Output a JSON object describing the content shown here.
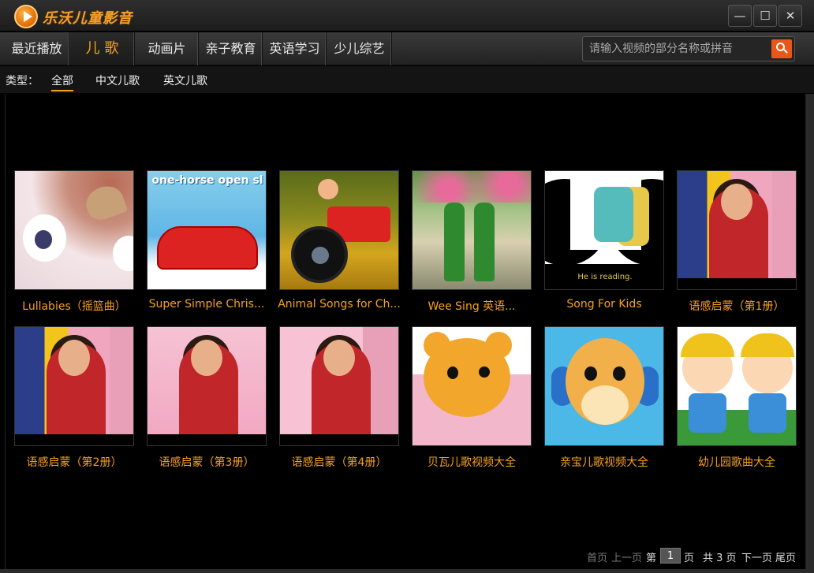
{
  "app": {
    "title": "乐沃儿童影音"
  },
  "window": {
    "minimize": "—",
    "maximize": "☐",
    "close": "✕"
  },
  "nav": {
    "items": [
      {
        "label": "最近播放",
        "active": false
      },
      {
        "label": "儿 歌",
        "active": true
      },
      {
        "label": "动画片",
        "active": false
      },
      {
        "label": "亲子教育",
        "active": false
      },
      {
        "label": "英语学习",
        "active": false
      },
      {
        "label": "少儿综艺",
        "active": false
      }
    ]
  },
  "search": {
    "placeholder": "请输入视频的部分名称或拼音",
    "value": ""
  },
  "filter": {
    "label": "类型：",
    "items": [
      {
        "label": "全部",
        "active": true
      },
      {
        "label": "中文儿歌",
        "active": false
      },
      {
        "label": "英文儿歌",
        "active": false
      }
    ]
  },
  "videos": [
    {
      "title": "Lullabies（摇篮曲）"
    },
    {
      "title": "Super Simple Chris...",
      "thumb_text": "one-horse open sl"
    },
    {
      "title": "Animal Songs for Ch..."
    },
    {
      "title": "Wee Sing 英语..."
    },
    {
      "title": "Song For Kids",
      "thumb_text": "He is reading."
    },
    {
      "title": "语感启蒙（第1册）"
    },
    {
      "title": "语感启蒙（第2册）"
    },
    {
      "title": "语感启蒙（第3册）"
    },
    {
      "title": "语感启蒙（第4册）"
    },
    {
      "title": "贝瓦儿歌视频大全"
    },
    {
      "title": "亲宝儿歌视频大全"
    },
    {
      "title": "幼儿园歌曲大全"
    }
  ],
  "pager": {
    "first": "首页",
    "prev": "上一页",
    "page_prefix": "第",
    "current_page": "1",
    "page_suffix": "页",
    "total": "共 3 页",
    "next": "下一页",
    "last": "尾页"
  },
  "colors": {
    "accent": "#f7a21c",
    "search_button": "#e8561a"
  }
}
